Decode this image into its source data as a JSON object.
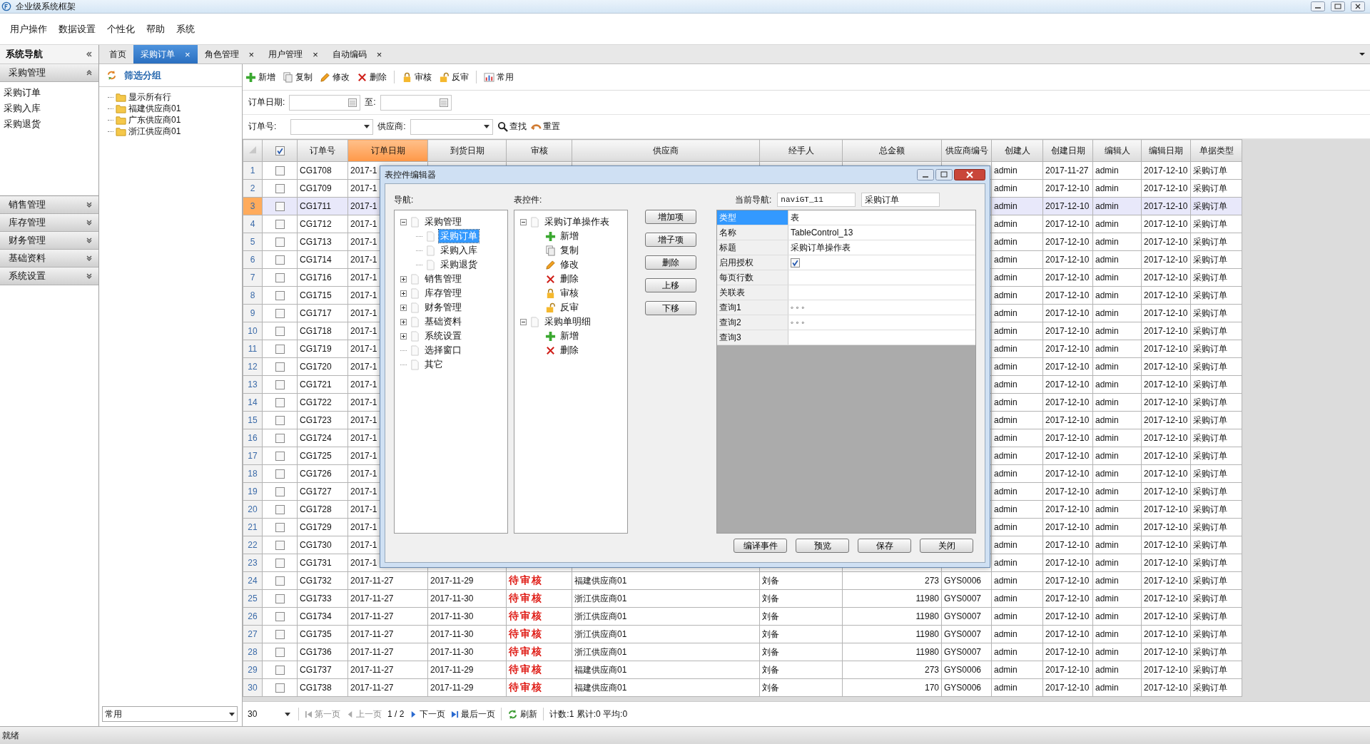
{
  "window": {
    "title": "企业级系统框架"
  },
  "menu": [
    "用户操作",
    "数据设置",
    "个性化",
    "帮助",
    "系统"
  ],
  "sidebar": {
    "title": "系统导航",
    "sections": [
      {
        "label": "采购管理",
        "expanded": true,
        "items": [
          "采购订单",
          "采购入库",
          "采购退货"
        ]
      },
      {
        "label": "销售管理",
        "expanded": false
      },
      {
        "label": "库存管理",
        "expanded": false
      },
      {
        "label": "财务管理",
        "expanded": false
      },
      {
        "label": "基础资料",
        "expanded": false
      },
      {
        "label": "系统设置",
        "expanded": false
      }
    ]
  },
  "tabs": [
    {
      "label": "首页",
      "selected": false
    },
    {
      "label": "采购订单",
      "selected": true,
      "close": "×"
    },
    {
      "label": "角色管理",
      "selected": false,
      "close": "×"
    },
    {
      "label": "用户管理",
      "selected": false,
      "close": "×"
    },
    {
      "label": "自动编码",
      "selected": false,
      "close": "×"
    }
  ],
  "filter_panel": {
    "title": "筛选分组",
    "items": [
      "显示所有行",
      "福建供应商01",
      "广东供应商01",
      "浙江供应商01"
    ],
    "view_select": "常用"
  },
  "toolbar": [
    {
      "kind": "add",
      "label": "新增"
    },
    {
      "kind": "copy",
      "label": "复制"
    },
    {
      "kind": "edit",
      "label": "修改"
    },
    {
      "kind": "delete",
      "label": "删除"
    },
    {
      "kind": "separator"
    },
    {
      "kind": "lock",
      "label": "审核"
    },
    {
      "kind": "unlock",
      "label": "反审"
    },
    {
      "kind": "separator"
    },
    {
      "kind": "chart",
      "label": "常用"
    }
  ],
  "filters": {
    "order_date_label": "订单日期:",
    "to_label": "至:",
    "order_no_label": "订单号:",
    "supplier_label": "供应商:",
    "search": "查找",
    "reset": "重置"
  },
  "table": {
    "header_checked": true,
    "columns": [
      {
        "label": "订单号",
        "selected": false
      },
      {
        "label": "订单日期",
        "selected": true
      },
      {
        "label": "到货日期",
        "selected": false
      },
      {
        "label": "审核",
        "selected": false
      },
      {
        "label": "供应商",
        "selected": false
      },
      {
        "label": "经手人",
        "selected": false
      },
      {
        "label": "总金额",
        "selected": false
      },
      {
        "label": "供应商编号",
        "selected": false
      },
      {
        "label": "创建人",
        "selected": false
      },
      {
        "label": "创建日期",
        "selected": false
      },
      {
        "label": "编辑人",
        "selected": false
      },
      {
        "label": "编辑日期",
        "selected": false
      },
      {
        "label": "单据类型",
        "selected": false
      }
    ],
    "rows": [
      {
        "no": "1",
        "checked": false,
        "selected": false,
        "order_no": "CG1708",
        "order_date": "2017-1",
        "creator": "admin",
        "created": "2017-11-27",
        "editor": "admin",
        "edited": "2017-12-10",
        "doc_type": "采购订单"
      },
      {
        "no": "2",
        "checked": false,
        "selected": false,
        "order_no": "CG1709",
        "order_date": "2017-1",
        "creator": "admin",
        "created": "2017-12-10",
        "editor": "admin",
        "edited": "2017-12-10",
        "doc_type": "采购订单"
      },
      {
        "no": "3",
        "checked": false,
        "selected": true,
        "order_no": "CG1711",
        "order_date": "2017-1",
        "creator": "admin",
        "created": "2017-12-10",
        "editor": "admin",
        "edited": "2017-12-10",
        "doc_type": "采购订单"
      },
      {
        "no": "4",
        "checked": false,
        "selected": false,
        "order_no": "CG1712",
        "order_date": "2017-1",
        "creator": "admin",
        "created": "2017-12-10",
        "editor": "admin",
        "edited": "2017-12-10",
        "doc_type": "采购订单"
      },
      {
        "no": "5",
        "checked": false,
        "selected": false,
        "order_no": "CG1713",
        "order_date": "2017-1",
        "creator": "admin",
        "created": "2017-12-10",
        "editor": "admin",
        "edited": "2017-12-10",
        "doc_type": "采购订单"
      },
      {
        "no": "6",
        "checked": false,
        "selected": false,
        "order_no": "CG1714",
        "order_date": "2017-1",
        "creator": "admin",
        "created": "2017-12-10",
        "editor": "admin",
        "edited": "2017-12-10",
        "doc_type": "采购订单"
      },
      {
        "no": "7",
        "checked": false,
        "selected": false,
        "order_no": "CG1716",
        "order_date": "2017-1",
        "creator": "admin",
        "created": "2017-12-10",
        "editor": "admin",
        "edited": "2017-12-10",
        "doc_type": "采购订单"
      },
      {
        "no": "8",
        "checked": false,
        "selected": false,
        "order_no": "CG1715",
        "order_date": "2017-1",
        "creator": "admin",
        "created": "2017-12-10",
        "editor": "admin",
        "edited": "2017-12-10",
        "doc_type": "采购订单"
      },
      {
        "no": "9",
        "checked": false,
        "selected": false,
        "order_no": "CG1717",
        "order_date": "2017-1",
        "creator": "admin",
        "created": "2017-12-10",
        "editor": "admin",
        "edited": "2017-12-10",
        "doc_type": "采购订单"
      },
      {
        "no": "10",
        "checked": false,
        "selected": false,
        "order_no": "CG1718",
        "order_date": "2017-1",
        "creator": "admin",
        "created": "2017-12-10",
        "editor": "admin",
        "edited": "2017-12-10",
        "doc_type": "采购订单"
      },
      {
        "no": "11",
        "checked": false,
        "selected": false,
        "order_no": "CG1719",
        "order_date": "2017-1",
        "creator": "admin",
        "created": "2017-12-10",
        "editor": "admin",
        "edited": "2017-12-10",
        "doc_type": "采购订单"
      },
      {
        "no": "12",
        "checked": false,
        "selected": false,
        "order_no": "CG1720",
        "order_date": "2017-1",
        "creator": "admin",
        "created": "2017-12-10",
        "editor": "admin",
        "edited": "2017-12-10",
        "doc_type": "采购订单"
      },
      {
        "no": "13",
        "checked": false,
        "selected": false,
        "order_no": "CG1721",
        "order_date": "2017-1",
        "creator": "admin",
        "created": "2017-12-10",
        "editor": "admin",
        "edited": "2017-12-10",
        "doc_type": "采购订单"
      },
      {
        "no": "14",
        "checked": false,
        "selected": false,
        "order_no": "CG1722",
        "order_date": "2017-1",
        "creator": "admin",
        "created": "2017-12-10",
        "editor": "admin",
        "edited": "2017-12-10",
        "doc_type": "采购订单"
      },
      {
        "no": "15",
        "checked": false,
        "selected": false,
        "order_no": "CG1723",
        "order_date": "2017-1",
        "creator": "admin",
        "created": "2017-12-10",
        "editor": "admin",
        "edited": "2017-12-10",
        "doc_type": "采购订单"
      },
      {
        "no": "16",
        "checked": false,
        "selected": false,
        "order_no": "CG1724",
        "order_date": "2017-1",
        "creator": "admin",
        "created": "2017-12-10",
        "editor": "admin",
        "edited": "2017-12-10",
        "doc_type": "采购订单"
      },
      {
        "no": "17",
        "checked": false,
        "selected": false,
        "order_no": "CG1725",
        "order_date": "2017-1",
        "creator": "admin",
        "created": "2017-12-10",
        "editor": "admin",
        "edited": "2017-12-10",
        "doc_type": "采购订单"
      },
      {
        "no": "18",
        "checked": false,
        "selected": false,
        "order_no": "CG1726",
        "order_date": "2017-1",
        "creator": "admin",
        "created": "2017-12-10",
        "editor": "admin",
        "edited": "2017-12-10",
        "doc_type": "采购订单"
      },
      {
        "no": "19",
        "checked": false,
        "selected": false,
        "order_no": "CG1727",
        "order_date": "2017-1",
        "creator": "admin",
        "created": "2017-12-10",
        "editor": "admin",
        "edited": "2017-12-10",
        "doc_type": "采购订单"
      },
      {
        "no": "20",
        "checked": false,
        "selected": false,
        "order_no": "CG1728",
        "order_date": "2017-1",
        "creator": "admin",
        "created": "2017-12-10",
        "editor": "admin",
        "edited": "2017-12-10",
        "doc_type": "采购订单"
      },
      {
        "no": "21",
        "checked": false,
        "selected": false,
        "order_no": "CG1729",
        "order_date": "2017-1",
        "creator": "admin",
        "created": "2017-12-10",
        "editor": "admin",
        "edited": "2017-12-10",
        "doc_type": "采购订单"
      },
      {
        "no": "22",
        "checked": false,
        "selected": false,
        "order_no": "CG1730",
        "order_date": "2017-1",
        "creator": "admin",
        "created": "2017-12-10",
        "editor": "admin",
        "edited": "2017-12-10",
        "doc_type": "采购订单"
      },
      {
        "no": "23",
        "checked": false,
        "selected": false,
        "order_no": "CG1731",
        "order_date": "2017-1",
        "creator": "admin",
        "created": "2017-12-10",
        "editor": "admin",
        "edited": "2017-12-10",
        "doc_type": "采购订单"
      },
      {
        "no": "24",
        "checked": false,
        "selected": false,
        "order_no": "CG1732",
        "order_date": "2017-11-27",
        "arrival": "2017-11-29",
        "audit": "待审核",
        "supplier": "福建供应商01",
        "handler": "刘备",
        "amount": "273",
        "supplier_code": "GYS0006",
        "creator": "admin",
        "created": "2017-12-10",
        "editor": "admin",
        "edited": "2017-12-10",
        "doc_type": "采购订单"
      },
      {
        "no": "25",
        "checked": false,
        "selected": false,
        "order_no": "CG1733",
        "order_date": "2017-11-27",
        "arrival": "2017-11-30",
        "audit": "待审核",
        "supplier": "浙江供应商01",
        "handler": "刘备",
        "amount": "11980",
        "supplier_code": "GYS0007",
        "creator": "admin",
        "created": "2017-12-10",
        "editor": "admin",
        "edited": "2017-12-10",
        "doc_type": "采购订单"
      },
      {
        "no": "26",
        "checked": false,
        "selected": false,
        "order_no": "CG1734",
        "order_date": "2017-11-27",
        "arrival": "2017-11-30",
        "audit": "待审核",
        "supplier": "浙江供应商01",
        "handler": "刘备",
        "amount": "11980",
        "supplier_code": "GYS0007",
        "creator": "admin",
        "created": "2017-12-10",
        "editor": "admin",
        "edited": "2017-12-10",
        "doc_type": "采购订单"
      },
      {
        "no": "27",
        "checked": false,
        "selected": false,
        "order_no": "CG1735",
        "order_date": "2017-11-27",
        "arrival": "2017-11-30",
        "audit": "待审核",
        "supplier": "浙江供应商01",
        "handler": "刘备",
        "amount": "11980",
        "supplier_code": "GYS0007",
        "creator": "admin",
        "created": "2017-12-10",
        "editor": "admin",
        "edited": "2017-12-10",
        "doc_type": "采购订单"
      },
      {
        "no": "28",
        "checked": false,
        "selected": false,
        "order_no": "CG1736",
        "order_date": "2017-11-27",
        "arrival": "2017-11-30",
        "audit": "待审核",
        "supplier": "浙江供应商01",
        "handler": "刘备",
        "amount": "11980",
        "supplier_code": "GYS0007",
        "creator": "admin",
        "created": "2017-12-10",
        "editor": "admin",
        "edited": "2017-12-10",
        "doc_type": "采购订单"
      },
      {
        "no": "29",
        "checked": false,
        "selected": false,
        "order_no": "CG1737",
        "order_date": "2017-11-27",
        "arrival": "2017-11-29",
        "audit": "待审核",
        "supplier": "福建供应商01",
        "handler": "刘备",
        "amount": "273",
        "supplier_code": "GYS0006",
        "creator": "admin",
        "created": "2017-12-10",
        "editor": "admin",
        "edited": "2017-12-10",
        "doc_type": "采购订单"
      },
      {
        "no": "30",
        "checked": false,
        "selected": false,
        "order_no": "CG1738",
        "order_date": "2017-11-27",
        "arrival": "2017-11-29",
        "audit": "待审核",
        "supplier": "福建供应商01",
        "handler": "刘备",
        "amount": "170",
        "supplier_code": "GYS0006",
        "creator": "admin",
        "created": "2017-12-10",
        "editor": "admin",
        "edited": "2017-12-10",
        "doc_type": "采购订单"
      }
    ]
  },
  "pager": {
    "page_size": "30",
    "nav": [
      {
        "kind": "first",
        "label": "第一页",
        "disabled": true
      },
      {
        "kind": "prev",
        "label": "上一页",
        "disabled": true
      },
      {
        "kind": "next",
        "label": "下一页",
        "disabled": false
      },
      {
        "kind": "last",
        "label": "最后一页",
        "disabled": false
      }
    ],
    "page": "1 / 2",
    "refresh": "刷新",
    "stats": "计数:1 累计:0 平均:0"
  },
  "status_bar": "就绪",
  "dialog": {
    "title": "表控件编辑器",
    "nav_label": "导航:",
    "nav_tree": [
      {
        "label": "采购管理",
        "kind": "group",
        "expanded": true,
        "selected": false,
        "children": [
          {
            "label": "采购订单",
            "kind": "leaf",
            "selected": true
          },
          {
            "label": "采购入库",
            "kind": "leaf",
            "selected": false
          },
          {
            "label": "采购退货",
            "kind": "leaf",
            "selected": false
          }
        ]
      },
      {
        "label": "销售管理",
        "kind": "group",
        "expanded": false,
        "selected": false
      },
      {
        "label": "库存管理",
        "kind": "group",
        "expanded": false,
        "selected": false
      },
      {
        "label": "财务管理",
        "kind": "group",
        "expanded": false,
        "selected": false
      },
      {
        "label": "基础资料",
        "kind": "group",
        "expanded": false,
        "selected": false
      },
      {
        "label": "系统设置",
        "kind": "group",
        "expanded": false,
        "selected": false
      },
      {
        "label": "选择窗口",
        "kind": "leaf",
        "selected": false
      },
      {
        "label": "其它",
        "kind": "leaf",
        "selected": false
      }
    ],
    "controls_label": "表控件:",
    "control_tree": [
      {
        "label": "采购订单操作表",
        "expanded": true,
        "children": [
          {
            "label": "新增",
            "kind": "add"
          },
          {
            "label": "复制",
            "kind": "copy"
          },
          {
            "label": "修改",
            "kind": "edit"
          },
          {
            "label": "删除",
            "kind": "delete"
          },
          {
            "label": "审核",
            "kind": "lock"
          },
          {
            "label": "反审",
            "kind": "unlock"
          }
        ]
      },
      {
        "label": "采购单明细",
        "expanded": true,
        "children": [
          {
            "label": "新增",
            "kind": "add"
          },
          {
            "label": "删除",
            "kind": "delete"
          }
        ]
      }
    ],
    "side_buttons": [
      "增加项",
      "增子项",
      "删除",
      "上移",
      "下移"
    ],
    "current_label": "当前导航:",
    "current_code": "naviGT_11",
    "current_name": "采购订单",
    "properties": [
      {
        "name": "类型",
        "kind": "text",
        "value": "表",
        "selected": true
      },
      {
        "name": "名称",
        "kind": "text",
        "value": "TableControl_13",
        "selected": false
      },
      {
        "name": "标题",
        "kind": "text",
        "value": "采购订单操作表",
        "selected": false
      },
      {
        "name": "启用授权",
        "kind": "checkbox",
        "checked": true,
        "selected": false
      },
      {
        "name": "每页行数",
        "kind": "text",
        "selected": false
      },
      {
        "name": "关联表",
        "kind": "text",
        "selected": false
      },
      {
        "name": "查询1",
        "kind": "text",
        "value": "◦ ◦ ◦",
        "selected": false
      },
      {
        "name": "查询2",
        "kind": "text",
        "value": "◦ ◦ ◦",
        "selected": false
      },
      {
        "name": "查询3",
        "kind": "text",
        "selected": false
      }
    ],
    "buttons": [
      "编译事件",
      "预览",
      "保存",
      "关闭"
    ]
  }
}
